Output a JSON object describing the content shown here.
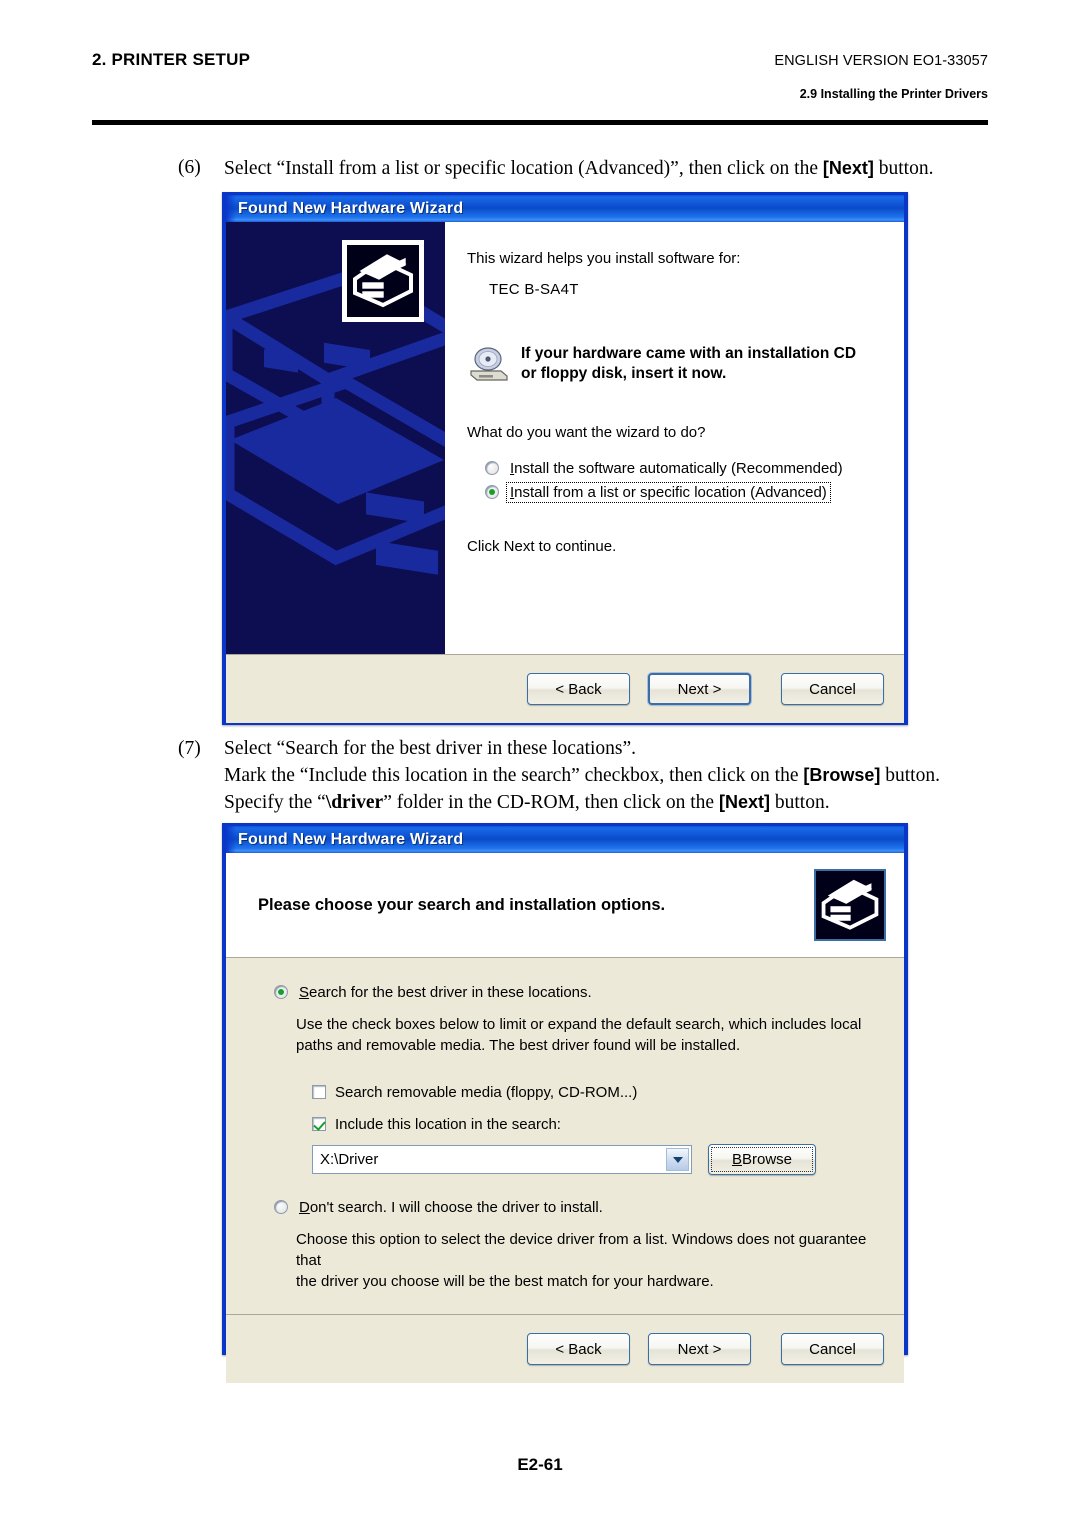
{
  "header": {
    "left_title": "2. PRINTER SETUP",
    "right_version": "ENGLISH VERSION EO1-33057",
    "right_section": "2.9 Installing the Printer Drivers"
  },
  "steps": {
    "six": {
      "number": "(6)",
      "text_before": "Select “Install from a list or specific location (Advanced)”, then click on the ",
      "button": "[Next]",
      "text_after": " button."
    },
    "seven": {
      "number": "(7)",
      "line1": "Select “Search for the best driver in these locations”.",
      "line2_before": "Mark the “Include this location in the search” checkbox, then click on the ",
      "line2_button": "[Browse]",
      "line2_after": " button.",
      "line3_before": "Specify the “",
      "line3_driver": "\\driver",
      "line3_mid": "” folder in the CD-ROM, then click on the ",
      "line3_button": "[Next]",
      "line3_after": " button."
    }
  },
  "dialog1": {
    "title": "Found New Hardware Wizard",
    "intro": "This wizard helps you install software for:",
    "device": "TEC B-SA4T",
    "cd_notice_line1": "If your hardware came with an installation CD",
    "cd_notice_line2": "or floppy disk, insert it now.",
    "question": "What do you want the wizard to do?",
    "options": [
      {
        "label": "Install the software automatically (Recommended)",
        "accel": "I",
        "selected": false,
        "focused": false
      },
      {
        "label": "Install from a list or specific location (Advanced)",
        "accel": "I",
        "selected": true,
        "focused": true
      }
    ],
    "click_next": "Click Next to continue.",
    "buttons": {
      "back": "< Back",
      "next": "Next >",
      "cancel": "Cancel"
    }
  },
  "dialog2": {
    "title": "Found New Hardware Wizard",
    "heading": "Please choose your search and installation options.",
    "option_search": {
      "label": "Search for the best driver in these locations.",
      "selected": true
    },
    "search_desc_line1": "Use the check boxes below to limit or expand the default search, which includes local",
    "search_desc_line2": "paths and removable media. The best driver found will be installed.",
    "checkbox_removable": {
      "label": "Search removable media (floppy, CD-ROM...)",
      "checked": false
    },
    "checkbox_include": {
      "label": "Include this location in the search:",
      "checked": true
    },
    "path_value": "X:\\Driver",
    "browse_label": "Browse",
    "option_dontsearch": {
      "label": "Don't search. I will choose the driver to install.",
      "selected": false
    },
    "dontsearch_desc_line1": "Choose this option to select the device driver from a list.  Windows does not guarantee that",
    "dontsearch_desc_line2": "the driver you choose will be the best match for your hardware.",
    "buttons": {
      "back": "< Back",
      "next": "Next >",
      "cancel": "Cancel"
    }
  },
  "footer": {
    "page_number": "E2-61"
  },
  "colors": {
    "title_blue": "#0a4fd0",
    "dialog_border": "#0a36c8",
    "dialog_face": "#ece9d8",
    "wizard_panel": "#0d0d52",
    "radio_green": "#16a02a"
  }
}
